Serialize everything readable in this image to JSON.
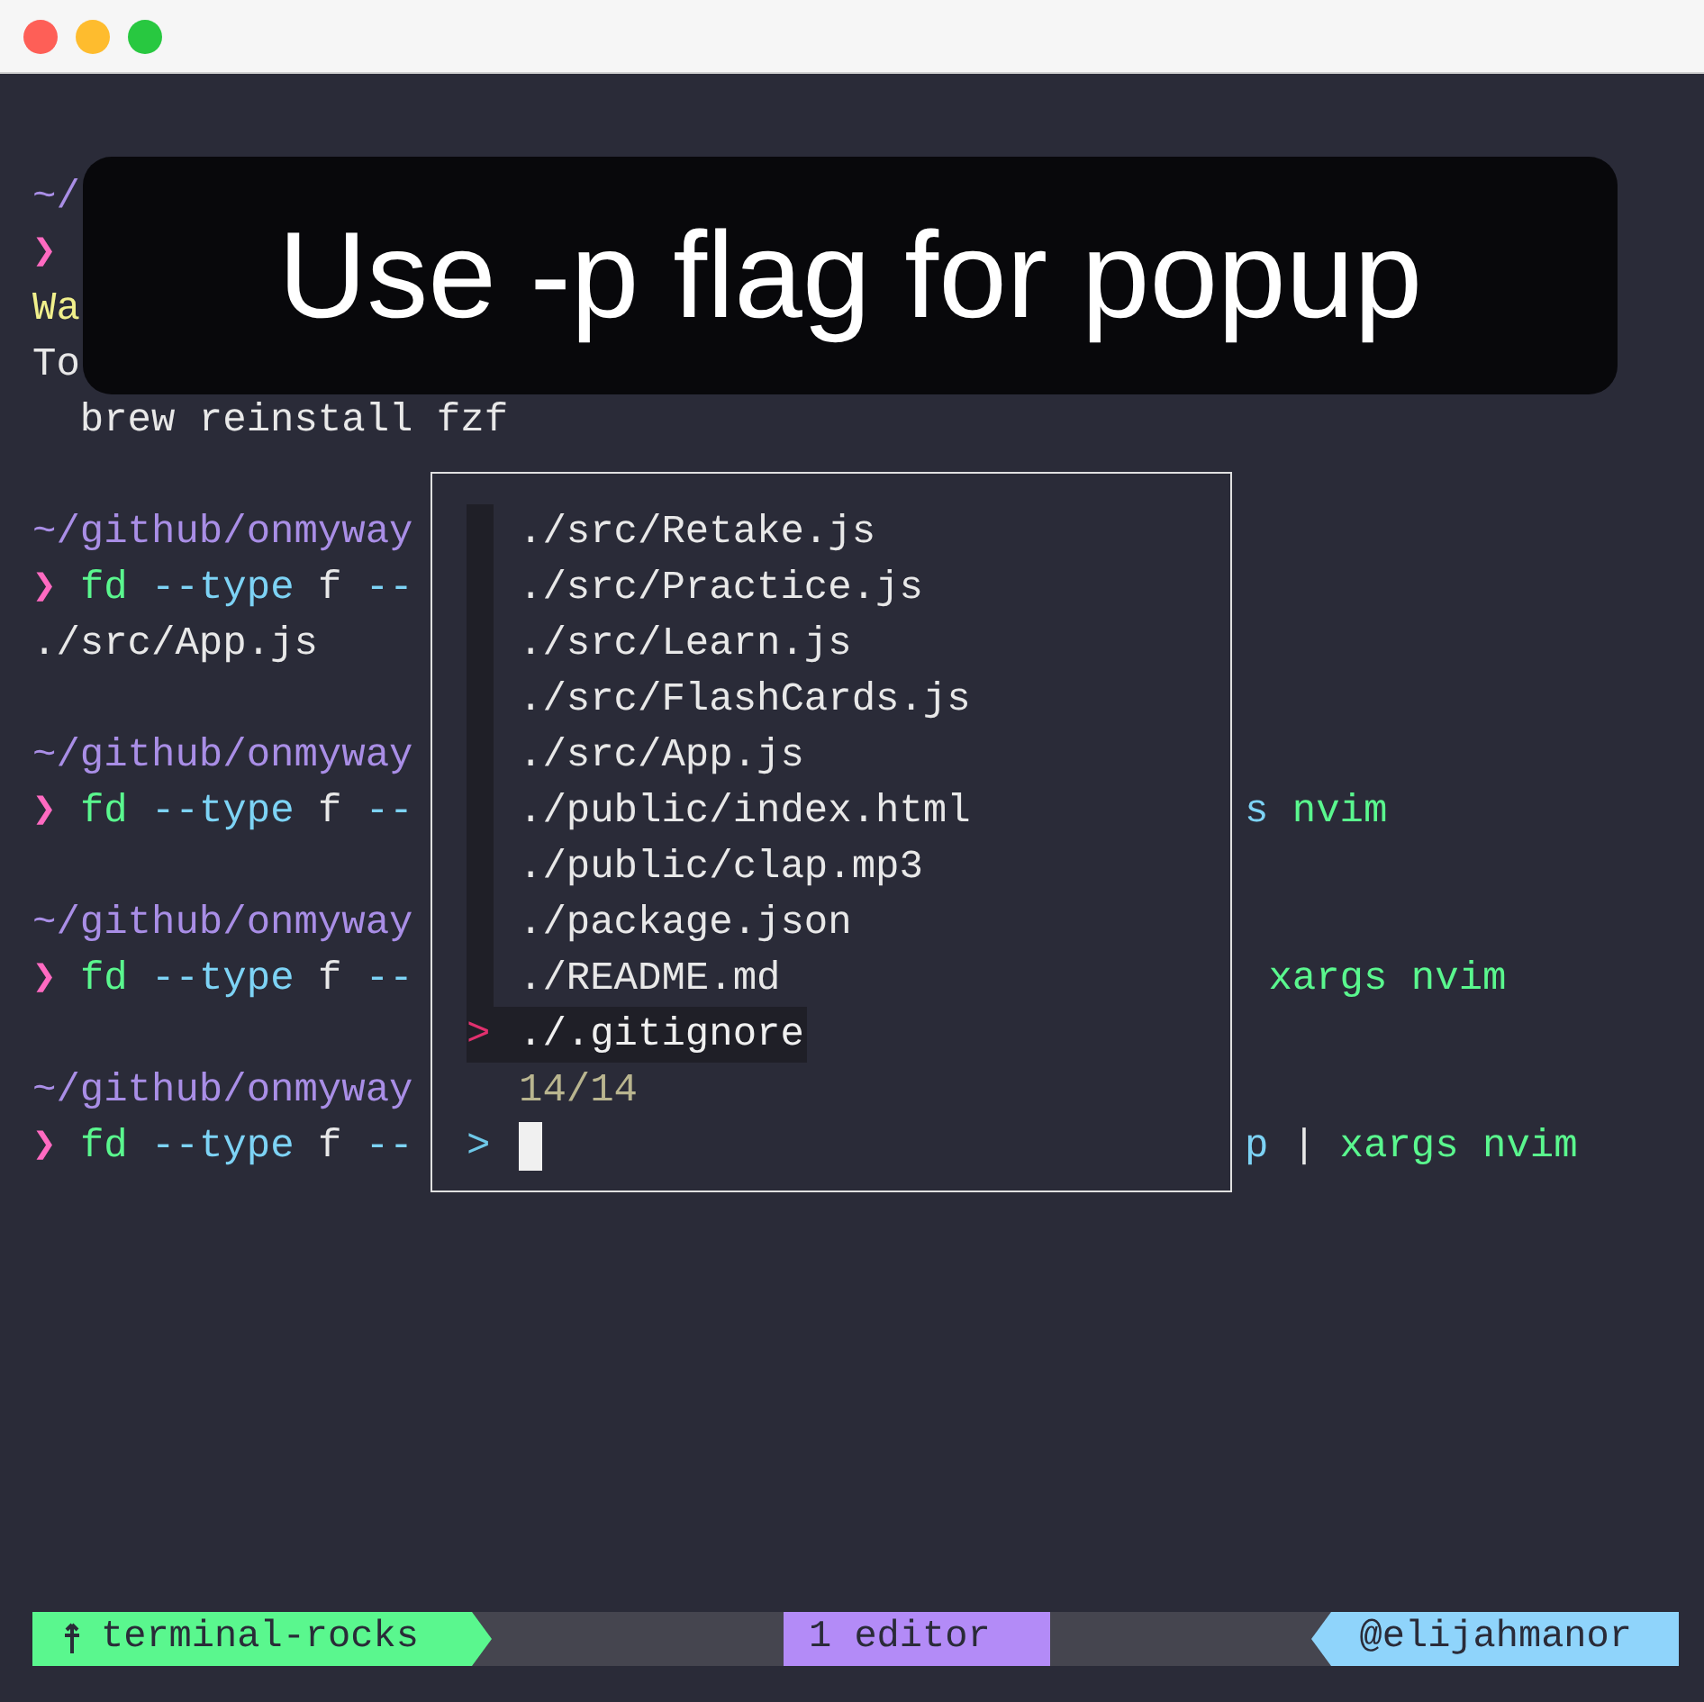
{
  "window": {
    "controls": [
      {
        "kind": "close"
      },
      {
        "kind": "minimize"
      },
      {
        "kind": "maximize"
      }
    ]
  },
  "terminal": {
    "blocks": [
      {
        "lines": [
          {
            "segments": [
              {
                "kind": "path",
                "text": "~/"
              }
            ]
          },
          {
            "segments": [
              {
                "kind": "symbol",
                "text": "❯"
              }
            ]
          },
          {
            "segments": [
              {
                "kind": "warning",
                "text": "Wa"
              }
            ]
          },
          {
            "segments": [
              {
                "kind": "text",
                "text": "To"
              }
            ]
          },
          {
            "segments": [
              {
                "kind": "text",
                "text": "  brew reinstall fzf"
              }
            ]
          }
        ]
      },
      {
        "lines": [
          {
            "segments": [
              {
                "kind": "path",
                "text": "~/github/onmyway"
              }
            ]
          },
          {
            "segments": [
              {
                "kind": "symbol",
                "text": "❯"
              },
              {
                "kind": "command",
                "text": " fd"
              },
              {
                "kind": "flag",
                "text": " --type"
              },
              {
                "kind": "text",
                "text": " f"
              },
              {
                "kind": "flag",
                "text": " --"
              }
            ]
          },
          {
            "segments": [
              {
                "kind": "text",
                "text": "./src/App.js"
              }
            ]
          }
        ]
      },
      {
        "lines": [
          {
            "segments": [
              {
                "kind": "path",
                "text": "~/github/onmyway"
              }
            ]
          },
          {
            "segments": [
              {
                "kind": "symbol",
                "text": "❯"
              },
              {
                "kind": "command",
                "text": " fd"
              },
              {
                "kind": "flag",
                "text": " --type"
              },
              {
                "kind": "text",
                "text": " f"
              },
              {
                "kind": "flag",
                "text": " --"
              }
            ],
            "trailing": [
              {
                "kind": "flag",
                "text": "s"
              },
              {
                "kind": "command",
                "text": " nvim"
              }
            ]
          }
        ]
      },
      {
        "lines": [
          {
            "segments": [
              {
                "kind": "path",
                "text": "~/github/onmyway"
              }
            ]
          },
          {
            "segments": [
              {
                "kind": "symbol",
                "text": "❯"
              },
              {
                "kind": "command",
                "text": " fd"
              },
              {
                "kind": "flag",
                "text": " --type"
              },
              {
                "kind": "text",
                "text": " f"
              },
              {
                "kind": "flag",
                "text": " --"
              }
            ],
            "trailing": [
              {
                "kind": "command",
                "text": " xargs nvim"
              }
            ]
          }
        ]
      },
      {
        "lines": [
          {
            "segments": [
              {
                "kind": "path",
                "text": "~/github/onmyway"
              }
            ]
          },
          {
            "segments": [
              {
                "kind": "symbol",
                "text": "❯"
              },
              {
                "kind": "command",
                "text": " fd"
              },
              {
                "kind": "flag",
                "text": " --type"
              },
              {
                "kind": "text",
                "text": " f"
              },
              {
                "kind": "flag",
                "text": " --"
              }
            ],
            "trailing": [
              {
                "kind": "flag",
                "text": "p"
              },
              {
                "kind": "text",
                "text": " |"
              },
              {
                "kind": "command",
                "text": " xargs nvim"
              }
            ]
          }
        ]
      }
    ]
  },
  "caption": "Use -p flag for popup",
  "popup": {
    "items": [
      {
        "label": "./src/Retake.js",
        "selected": false
      },
      {
        "label": "./src/Practice.js",
        "selected": false
      },
      {
        "label": "./src/Learn.js",
        "selected": false
      },
      {
        "label": "./src/FlashCards.js",
        "selected": false
      },
      {
        "label": "./src/App.js",
        "selected": false
      },
      {
        "label": "./public/index.html",
        "selected": false
      },
      {
        "label": "./public/clap.mp3",
        "selected": false
      },
      {
        "label": "./package.json",
        "selected": false
      },
      {
        "label": "./README.md",
        "selected": false
      },
      {
        "label": "./.gitignore",
        "selected": true
      }
    ],
    "pointer": ">",
    "count": "14/14",
    "prompt": ">"
  },
  "status_bar": {
    "session": "terminal-rocks",
    "window": "1 editor",
    "user": "@elijahmanor"
  }
}
